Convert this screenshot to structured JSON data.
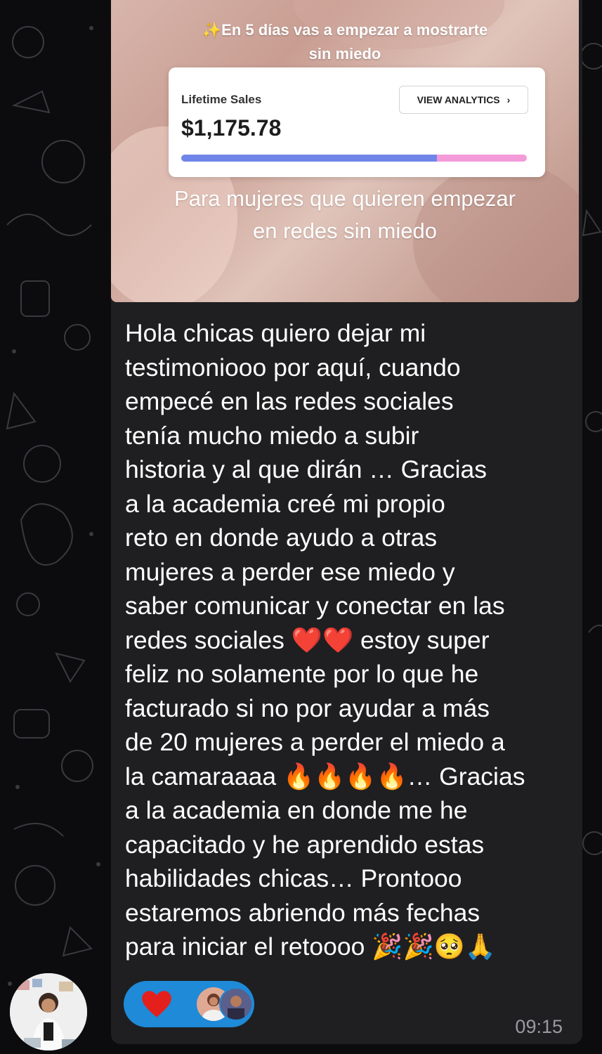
{
  "media": {
    "caption_line1": "En 5 días vas a empezar a mostrarte",
    "caption_line2": "sin miedo",
    "sparkle_icon": "sparkles",
    "card": {
      "label": "Lifetime Sales",
      "amount": "$1,175.78",
      "button_label": "VIEW ANALYTICS",
      "progress_blue": 0.74,
      "progress_pink": 0.26,
      "colors": {
        "blue": "#6f86e8",
        "pink": "#f49ad8"
      }
    },
    "subcaption_line1": "Para mujeres que quieren empezar",
    "subcaption_line2": "en redes sin miedo"
  },
  "message": {
    "lines": [
      "Hola chicas quiero dejar mi",
      "testimoniooo por aquí, cuando",
      "empecé en las redes sociales",
      "tenía mucho miedo a subir",
      "historia y al que dirán … Gracias",
      "a la academia creé mi propio",
      "reto en donde ayudo a otras",
      "mujeres a perder ese miedo y",
      "saber comunicar y conectar en las",
      "redes sociales ❤️❤️ estoy super",
      "feliz no solamente por lo que he",
      "facturado si no por ayudar a más",
      "de 20 mujeres a perder el miedo a",
      "la camaraaaa 🔥🔥🔥🔥… Gracias",
      "a la academia en donde me he",
      "capacitado y he aprendido estas",
      "habilidades chicas… Prontooo",
      "estaremos abriendo más fechas",
      "para iniciar el retoooo 🎉🎉🥺🙏"
    ]
  },
  "reactions": {
    "emoji_icon": "red-heart",
    "bubble_color": "#1e8ad8"
  },
  "timestamp": "09:15"
}
